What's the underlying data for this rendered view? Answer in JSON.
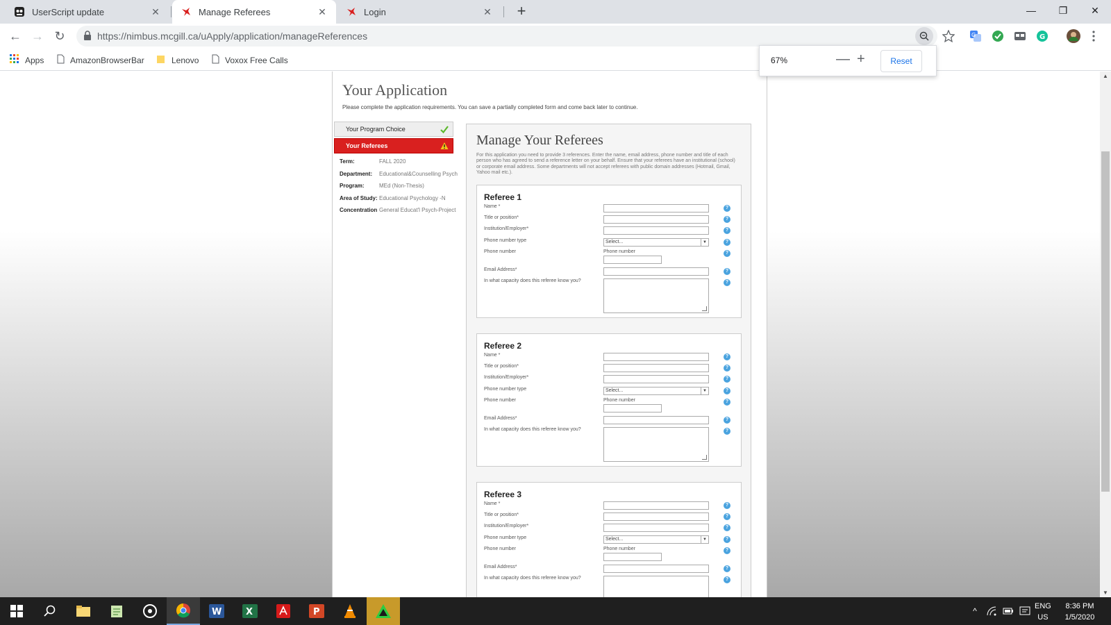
{
  "browser": {
    "tabs": [
      {
        "label": "UserScript update",
        "icon": "userscript-icon"
      },
      {
        "label": "Manage Referees",
        "icon": "mcgill-icon"
      },
      {
        "label": "Login",
        "icon": "mcgill-icon"
      }
    ],
    "url": "https://nimbus.mcgill.ca/uApply/application/manageReferences",
    "bookmarks": [
      "Apps",
      "AmazonBrowserBar",
      "Lenovo",
      "Voxox Free Calls"
    ],
    "zoom": {
      "value": "67%",
      "minus": "—",
      "plus": "+",
      "reset": "Reset"
    }
  },
  "page": {
    "title": "Your Application",
    "subtitle": "Please complete the application requirements. You can save a partially completed form and come back later to continue.",
    "nav": [
      {
        "label": "Your Program Choice",
        "status": "complete"
      },
      {
        "label": "Your Referees",
        "status": "warning"
      }
    ],
    "details": [
      {
        "label": "Term:",
        "value": "FALL 2020"
      },
      {
        "label": "Department:",
        "value": "Educational&Counselling Psych"
      },
      {
        "label": "Program:",
        "value": "MEd (Non-Thesis)"
      },
      {
        "label": "Area of Study:",
        "value": "Educational Psychology -N"
      },
      {
        "label": "Concentration",
        "value": "General Educat'l Psych-Project"
      }
    ],
    "main": {
      "title": "Manage Your Referees",
      "description": "For this application you need to provide 3 references. Enter the name, email address, phone number and title of each person who has agreed to send a reference letter on your behalf. Ensure that your referees have an institutional (school) or corporate email address. Some departments will not accept referees with public domain addresses (Hotmail, Gmail, Yahoo mail etc.).",
      "field_labels": {
        "name": "Name *",
        "title": "Title or position*",
        "institution": "Institution/Employer*",
        "phone_type": "Phone number type",
        "phone": "Phone number",
        "email": "Email Address*",
        "capacity": "In what capacity does this referee know you?"
      },
      "phone_type_selected": "Select...",
      "phone_sublabel": "Phone number",
      "referees": [
        {
          "title": "Referee 1"
        },
        {
          "title": "Referee 2"
        },
        {
          "title": "Referee 3"
        }
      ]
    }
  },
  "taskbar": {
    "lang": [
      "ENG",
      "US"
    ],
    "time": "8:36 PM",
    "date": "1/5/2020"
  }
}
